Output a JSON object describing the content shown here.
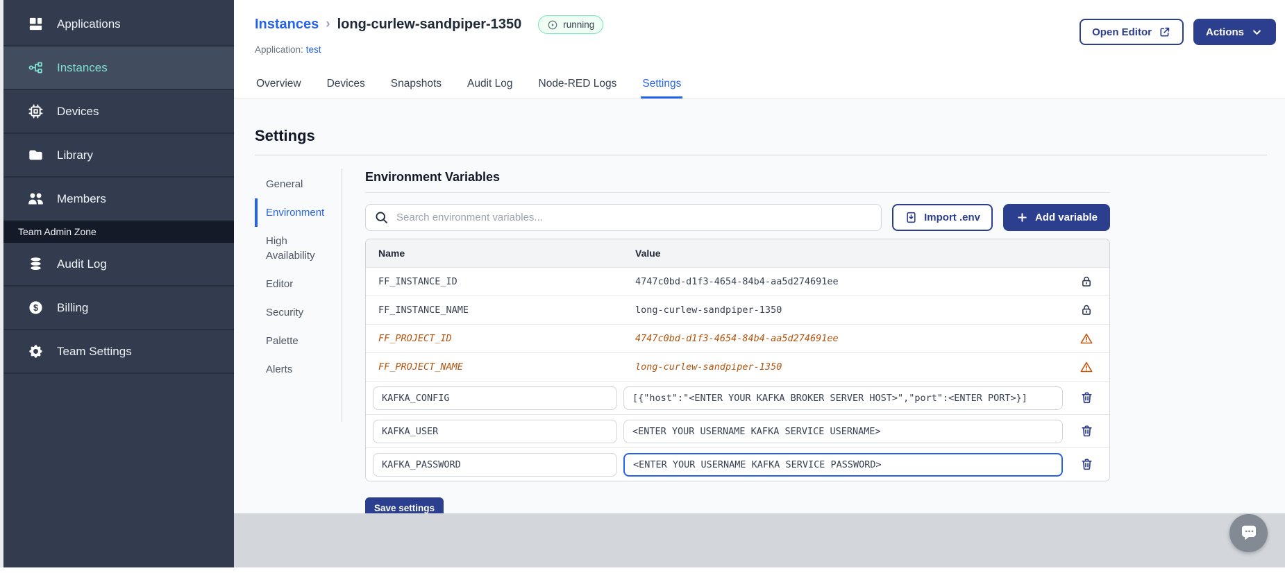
{
  "colors": {
    "navy": "#2c3e8e",
    "accent": "#2563eb",
    "sidebar-bg": "#333c4e",
    "sidebar-active-bg": "#414c5f",
    "teal": "#7fe0cf",
    "running-border": "#6ee7b7",
    "running-bg": "#f0fdf4",
    "deprecated": "#b0540e",
    "warning": "#c2540c"
  },
  "sidebar": {
    "items": [
      {
        "label": "Applications",
        "icon": "applications-icon",
        "active": false
      },
      {
        "label": "Instances",
        "icon": "instances-icon",
        "active": true
      },
      {
        "label": "Devices",
        "icon": "devices-icon",
        "active": false
      },
      {
        "label": "Library",
        "icon": "library-icon",
        "active": false
      },
      {
        "label": "Members",
        "icon": "members-icon",
        "active": false
      }
    ],
    "admin_zone_label": "Team Admin Zone",
    "admin_items": [
      {
        "label": "Audit Log",
        "icon": "audit-log-icon",
        "active": false
      },
      {
        "label": "Billing",
        "icon": "billing-icon",
        "active": false
      },
      {
        "label": "Team Settings",
        "icon": "team-settings-icon",
        "active": false
      }
    ]
  },
  "header": {
    "breadcrumb_parent": "Instances",
    "breadcrumb_separator": "›",
    "instance_name": "long-curlew-sandpiper-1350",
    "status_badge": "running",
    "application_label": "Application:",
    "application_name": "test",
    "open_editor_label": "Open Editor",
    "actions_label": "Actions"
  },
  "tabs": [
    {
      "label": "Overview",
      "active": false
    },
    {
      "label": "Devices",
      "active": false
    },
    {
      "label": "Snapshots",
      "active": false
    },
    {
      "label": "Audit Log",
      "active": false
    },
    {
      "label": "Node-RED Logs",
      "active": false
    },
    {
      "label": "Settings",
      "active": true
    }
  ],
  "settings": {
    "title": "Settings",
    "nav": [
      {
        "label": "General",
        "active": false
      },
      {
        "label": "Environment",
        "active": true
      },
      {
        "label": "High Availability",
        "active": false
      },
      {
        "label": "Editor",
        "active": false
      },
      {
        "label": "Security",
        "active": false
      },
      {
        "label": "Palette",
        "active": false
      },
      {
        "label": "Alerts",
        "active": false
      }
    ],
    "section_title": "Environment Variables",
    "search_placeholder": "Search environment variables...",
    "import_button": "Import .env",
    "add_button": "Add variable",
    "save_button": "Save settings",
    "table": {
      "columns": [
        "Name",
        "Value"
      ],
      "rows": [
        {
          "name": "FF_INSTANCE_ID",
          "value": "4747c0bd-d1f3-4654-84b4-aa5d274691ee",
          "type": "locked"
        },
        {
          "name": "FF_INSTANCE_NAME",
          "value": "long-curlew-sandpiper-1350",
          "type": "locked"
        },
        {
          "name": "FF_PROJECT_ID",
          "value": "4747c0bd-d1f3-4654-84b4-aa5d274691ee",
          "type": "deprecated"
        },
        {
          "name": "FF_PROJECT_NAME",
          "value": "long-curlew-sandpiper-1350",
          "type": "deprecated"
        },
        {
          "name": "KAFKA_CONFIG",
          "value": "[{\"host\":\"<ENTER YOUR KAFKA BROKER SERVER HOST>\",\"port\":<ENTER PORT>}]",
          "type": "editable",
          "focused": false
        },
        {
          "name": "KAFKA_USER",
          "value": "<ENTER YOUR USERNAME KAFKA SERVICE USERNAME>",
          "type": "editable",
          "focused": false
        },
        {
          "name": "KAFKA_PASSWORD",
          "value": "<ENTER YOUR USERNAME KAFKA SERVICE PASSWORD>",
          "type": "editable",
          "focused": true
        }
      ]
    }
  }
}
